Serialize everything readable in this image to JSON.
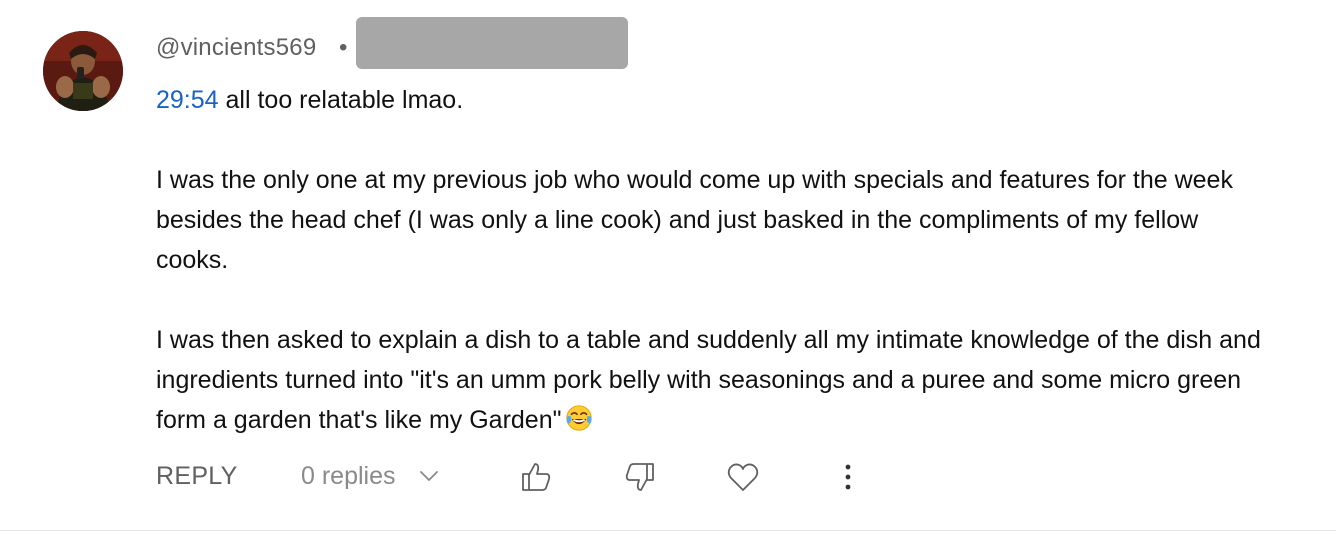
{
  "comment": {
    "author": "@vincients569",
    "separator": "•",
    "timestamp_link": "29:54",
    "first_line_rest": " all too relatable lmao.",
    "paragraph1_lines": [
      "I was the only one at my previous job who would come up with specials and features for the week",
      "besides the head chef (I was only a line cook) and just basked in the compliments of my fellow",
      "cooks."
    ],
    "paragraph2_lines": [
      "I was then asked to explain a dish to a table and suddenly all my intimate knowledge of the dish and",
      "ingredients turned into \"it's an umm pork belly with seasonings and a puree and some micro green",
      "form a garden that's like my Garden\""
    ],
    "emoji_name": "face-with-tears-of-joy-icon"
  },
  "actions": {
    "reply_label": "REPLY",
    "replies_label": "0 replies",
    "icons": [
      "chevron-down-icon",
      "thumbs-up-icon",
      "thumbs-down-icon",
      "heart-icon",
      "more-vertical-icon"
    ]
  },
  "colors": {
    "link": "#1a62c5",
    "secondary_text": "#606060",
    "redaction": "#a7a7a7"
  }
}
